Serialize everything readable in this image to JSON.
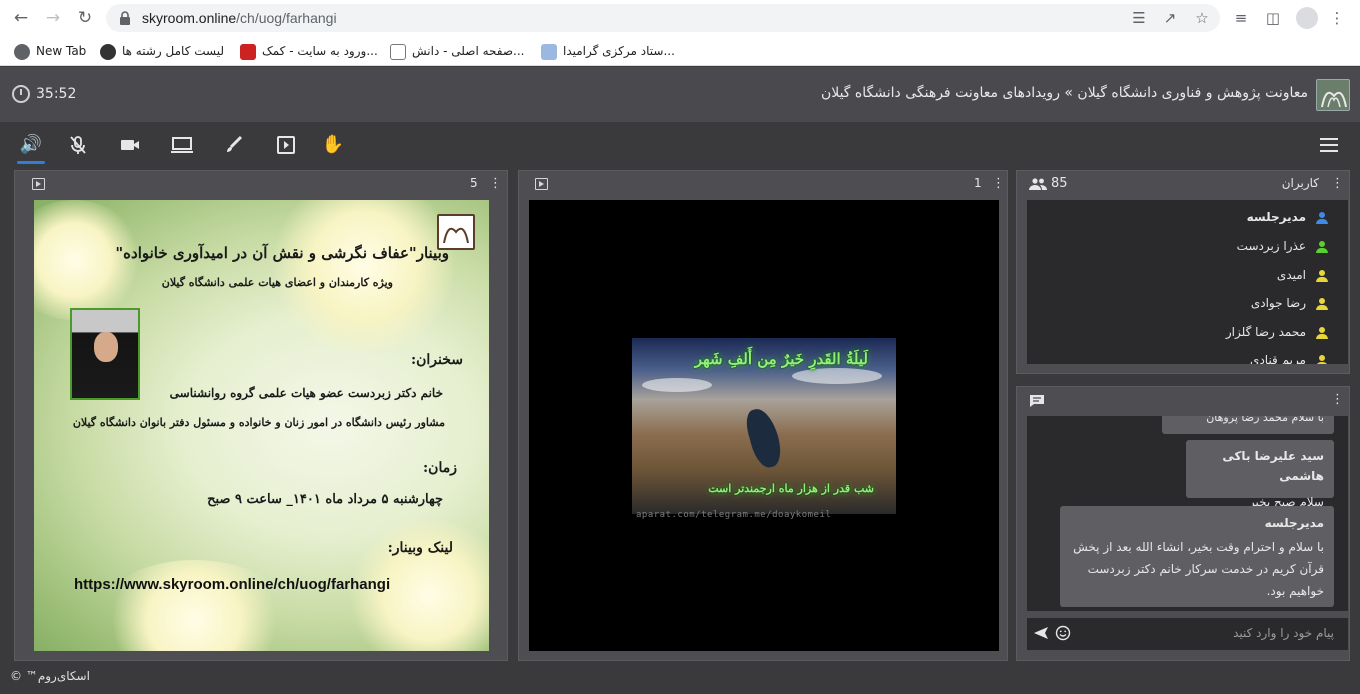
{
  "browser": {
    "url_host": "skyroom.online",
    "url_path": "/ch/uog/farhangi",
    "bookmarks": [
      {
        "label": "New Tab"
      },
      {
        "label": "لیست کامل رشته ها"
      },
      {
        "label": "ورود به سایت - کمک..."
      },
      {
        "label": "صفحه اصلی - دانش..."
      },
      {
        "label": "ستاد مرکزی گرامیدا..."
      }
    ]
  },
  "header": {
    "timer": "35:52",
    "breadcrumb": "معاونت پژوهش و فناوری دانشگاه گیلان » رویدادهای معاونت فرهنگی دانشگاه گیلان"
  },
  "toolbar": {
    "icons": [
      "speaker-icon",
      "mic-off-icon",
      "camera-icon",
      "screen-share-icon",
      "brush-icon",
      "media-icon",
      "raise-hand-icon"
    ]
  },
  "panel_left": {
    "number": "5",
    "poster": {
      "title": "وبینار\"عفاف نگرشی و نقش آن در امیدآوری خانواده\"",
      "subtitle": "ویژه کارمندان و اعضای هیات علمی دانشگاه گیلان",
      "speakers_label": "سخنران:",
      "speaker_name": "خانم دکتر زبردست عضو هیات علمی گروه روانشناسی",
      "speaker_role": "مشاور رئیس دانشگاه در امور زنان و خانواده و مسئول دفتر بانوان دانشگاه گیلان",
      "time_label": "زمان:",
      "time_value": "چهارشنبه ۵ مرداد ماه ۱۴۰۱_ ساعت ۹ صبح",
      "link_label": "لینک وبینار:",
      "link_url": "https://www.skyroom.online/ch/uog/farhangi"
    }
  },
  "panel_middle": {
    "number": "1",
    "video": {
      "caption_top": "لَیلَةُ القَدرِ خَیرٌ مِن أَلفِ شَهر",
      "caption_bottom": "شب قدر از هزار ماه ارجمندتر است",
      "watermark": "aparat.com/telegram.me/doaykomeil"
    }
  },
  "users_panel": {
    "title": "کاربران",
    "count": "85",
    "users": [
      {
        "name": "مدیرجلسه",
        "color": "#3d8be8",
        "bold": true
      },
      {
        "name": "عذرا زبردست",
        "color": "#5ad12f",
        "bold": false
      },
      {
        "name": "امیدی",
        "color": "#e6d63a",
        "bold": false
      },
      {
        "name": "رضا جوادی",
        "color": "#e6d63a",
        "bold": false
      },
      {
        "name": "محمد رضا گلزار",
        "color": "#e6d63a",
        "bold": false
      },
      {
        "name": "مریم قنادی",
        "color": "#e6d63a",
        "bold": false
      }
    ]
  },
  "chat_panel": {
    "messages": [
      {
        "author": "",
        "text": "با سلام محمد رضا پروهان"
      },
      {
        "author": "سید علیرضا باکی هاشمی",
        "text": "سلام صبح بخیر"
      },
      {
        "author": "مدیرجلسه",
        "text": "با سلام و احترام وقت بخیر، انشاء الله بعد از پخش قرآن کریم در خدمت سرکار خانم دکتر  زبردست خواهیم بود."
      }
    ],
    "input_placeholder": "پیام خود را وارد کنید"
  },
  "footer": {
    "text": "اسکای‌روم™ ©"
  }
}
